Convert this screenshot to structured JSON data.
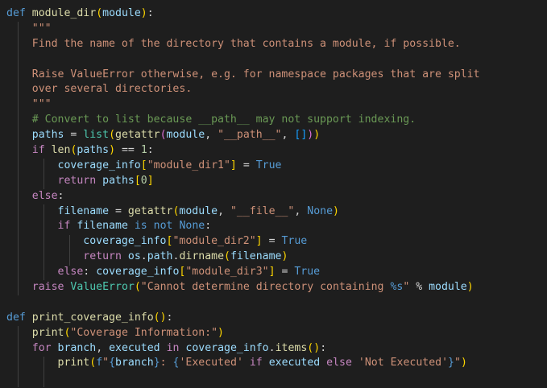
{
  "editor": {
    "language": "python",
    "colors": {
      "background": "#1e1e1e",
      "keyword": "#569cd6",
      "control": "#c586c0",
      "function": "#dcdcaa",
      "variable": "#9cdcfe",
      "string": "#ce9178",
      "number": "#b5cea8",
      "class": "#4ec9b0",
      "comment": "#6a9955",
      "text": "#d4d4d4",
      "bracket1": "#ffd700",
      "bracket2": "#da70d6",
      "bracket3": "#179fff"
    },
    "lines": [
      [
        [
          "kw",
          "def"
        ],
        [
          "plain",
          " "
        ],
        [
          "fn",
          "module_dir"
        ],
        [
          "br1",
          "("
        ],
        [
          "var",
          "module"
        ],
        [
          "br1",
          ")"
        ],
        [
          "plain",
          ":"
        ]
      ],
      [
        [
          "plain",
          "    "
        ],
        [
          "str",
          "\"\"\""
        ]
      ],
      [
        [
          "plain",
          "    "
        ],
        [
          "str",
          "Find the name of the directory that contains a module, if possible."
        ]
      ],
      [],
      [
        [
          "plain",
          "    "
        ],
        [
          "str",
          "Raise ValueError otherwise, e.g. for namespace packages that are split"
        ]
      ],
      [
        [
          "plain",
          "    "
        ],
        [
          "str",
          "over several directories."
        ]
      ],
      [
        [
          "plain",
          "    "
        ],
        [
          "str",
          "\"\"\""
        ]
      ],
      [
        [
          "plain",
          "    "
        ],
        [
          "com",
          "# Convert to list because __path__ may not support indexing."
        ]
      ],
      [
        [
          "plain",
          "    "
        ],
        [
          "var",
          "paths"
        ],
        [
          "plain",
          " = "
        ],
        [
          "cls",
          "list"
        ],
        [
          "br1",
          "("
        ],
        [
          "fn",
          "getattr"
        ],
        [
          "br2",
          "("
        ],
        [
          "var",
          "module"
        ],
        [
          "plain",
          ", "
        ],
        [
          "str",
          "\"__path__\""
        ],
        [
          "plain",
          ", "
        ],
        [
          "br3",
          "[]"
        ],
        [
          "br2",
          ")"
        ],
        [
          "br1",
          ")"
        ]
      ],
      [
        [
          "plain",
          "    "
        ],
        [
          "ctl",
          "if"
        ],
        [
          "plain",
          " "
        ],
        [
          "fn",
          "len"
        ],
        [
          "br1",
          "("
        ],
        [
          "var",
          "paths"
        ],
        [
          "br1",
          ")"
        ],
        [
          "plain",
          " == "
        ],
        [
          "num",
          "1"
        ],
        [
          "plain",
          ":"
        ]
      ],
      [
        [
          "plain",
          "        "
        ],
        [
          "var",
          "coverage_info"
        ],
        [
          "br1",
          "["
        ],
        [
          "str",
          "\"module_dir1\""
        ],
        [
          "br1",
          "]"
        ],
        [
          "plain",
          " = "
        ],
        [
          "const",
          "True"
        ]
      ],
      [
        [
          "plain",
          "        "
        ],
        [
          "ctl",
          "return"
        ],
        [
          "plain",
          " "
        ],
        [
          "var",
          "paths"
        ],
        [
          "br1",
          "["
        ],
        [
          "num",
          "0"
        ],
        [
          "br1",
          "]"
        ]
      ],
      [
        [
          "plain",
          "    "
        ],
        [
          "ctl",
          "else"
        ],
        [
          "plain",
          ":"
        ]
      ],
      [
        [
          "plain",
          "        "
        ],
        [
          "var",
          "filename"
        ],
        [
          "plain",
          " = "
        ],
        [
          "fn",
          "getattr"
        ],
        [
          "br1",
          "("
        ],
        [
          "var",
          "module"
        ],
        [
          "plain",
          ", "
        ],
        [
          "str",
          "\"__file__\""
        ],
        [
          "plain",
          ", "
        ],
        [
          "const",
          "None"
        ],
        [
          "br1",
          ")"
        ]
      ],
      [
        [
          "plain",
          "        "
        ],
        [
          "ctl",
          "if"
        ],
        [
          "plain",
          " "
        ],
        [
          "var",
          "filename"
        ],
        [
          "plain",
          " "
        ],
        [
          "kw",
          "is not"
        ],
        [
          "plain",
          " "
        ],
        [
          "const",
          "None"
        ],
        [
          "plain",
          ":"
        ]
      ],
      [
        [
          "plain",
          "            "
        ],
        [
          "var",
          "coverage_info"
        ],
        [
          "br1",
          "["
        ],
        [
          "str",
          "\"module_dir2\""
        ],
        [
          "br1",
          "]"
        ],
        [
          "plain",
          " = "
        ],
        [
          "const",
          "True"
        ]
      ],
      [
        [
          "plain",
          "            "
        ],
        [
          "ctl",
          "return"
        ],
        [
          "plain",
          " "
        ],
        [
          "var",
          "os"
        ],
        [
          "plain",
          "."
        ],
        [
          "var",
          "path"
        ],
        [
          "plain",
          "."
        ],
        [
          "fn",
          "dirname"
        ],
        [
          "br1",
          "("
        ],
        [
          "var",
          "filename"
        ],
        [
          "br1",
          ")"
        ]
      ],
      [
        [
          "plain",
          "        "
        ],
        [
          "ctl",
          "else"
        ],
        [
          "plain",
          ": "
        ],
        [
          "var",
          "coverage_info"
        ],
        [
          "br1",
          "["
        ],
        [
          "str",
          "\"module_dir3\""
        ],
        [
          "br1",
          "]"
        ],
        [
          "plain",
          " = "
        ],
        [
          "const",
          "True"
        ]
      ],
      [
        [
          "plain",
          "    "
        ],
        [
          "ctl",
          "raise"
        ],
        [
          "plain",
          " "
        ],
        [
          "cls",
          "ValueError"
        ],
        [
          "br1",
          "("
        ],
        [
          "str",
          "\"Cannot determine directory containing "
        ],
        [
          "const",
          "%s"
        ],
        [
          "str",
          "\""
        ],
        [
          "plain",
          " % "
        ],
        [
          "var",
          "module"
        ],
        [
          "br1",
          ")"
        ]
      ],
      [],
      [
        [
          "kw",
          "def"
        ],
        [
          "plain",
          " "
        ],
        [
          "fn",
          "print_coverage_info"
        ],
        [
          "br1",
          "()"
        ],
        [
          "plain",
          ":"
        ]
      ],
      [
        [
          "plain",
          "    "
        ],
        [
          "fn",
          "print"
        ],
        [
          "br1",
          "("
        ],
        [
          "str",
          "\"Coverage Information:\""
        ],
        [
          "br1",
          ")"
        ]
      ],
      [
        [
          "plain",
          "    "
        ],
        [
          "ctl",
          "for"
        ],
        [
          "plain",
          " "
        ],
        [
          "var",
          "branch"
        ],
        [
          "plain",
          ", "
        ],
        [
          "var",
          "executed"
        ],
        [
          "plain",
          " "
        ],
        [
          "ctl",
          "in"
        ],
        [
          "plain",
          " "
        ],
        [
          "var",
          "coverage_info"
        ],
        [
          "plain",
          "."
        ],
        [
          "fn",
          "items"
        ],
        [
          "br1",
          "("
        ],
        [
          "br1",
          ")"
        ],
        [
          "plain",
          ":"
        ]
      ],
      [
        [
          "plain",
          "        "
        ],
        [
          "fn",
          "print"
        ],
        [
          "br1",
          "("
        ],
        [
          "kw",
          "f"
        ],
        [
          "str",
          "\""
        ],
        [
          "kw",
          "{"
        ],
        [
          "var",
          "branch"
        ],
        [
          "kw",
          "}"
        ],
        [
          "str",
          ": "
        ],
        [
          "kw",
          "{"
        ],
        [
          "str",
          "'Executed'"
        ],
        [
          "plain",
          " "
        ],
        [
          "ctl",
          "if"
        ],
        [
          "plain",
          " "
        ],
        [
          "var",
          "executed"
        ],
        [
          "plain",
          " "
        ],
        [
          "ctl",
          "else"
        ],
        [
          "plain",
          " "
        ],
        [
          "str",
          "'Not Executed'"
        ],
        [
          "kw",
          "}"
        ],
        [
          "str",
          "\""
        ],
        [
          "br1",
          ")"
        ]
      ]
    ]
  }
}
